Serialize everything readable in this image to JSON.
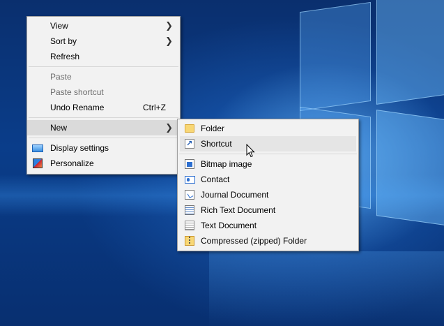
{
  "colors": {
    "menu_background": "#f2f2f2",
    "menu_highlight": "#dadada",
    "disabled_text": "#6d6d6d",
    "desktop_blue": "#0a3d8a"
  },
  "context_menu": {
    "items": [
      {
        "label": "View",
        "has_submenu": true
      },
      {
        "label": "Sort by",
        "has_submenu": true
      },
      {
        "label": "Refresh"
      },
      {
        "label": "Paste",
        "disabled": true
      },
      {
        "label": "Paste shortcut",
        "disabled": true
      },
      {
        "label": "Undo Rename",
        "shortcut": "Ctrl+Z"
      },
      {
        "label": "New",
        "has_submenu": true,
        "highlighted": true
      },
      {
        "label": "Display settings",
        "icon": "display-icon"
      },
      {
        "label": "Personalize",
        "icon": "personalize-icon"
      }
    ]
  },
  "new_submenu": {
    "items": [
      {
        "label": "Folder",
        "icon": "folder-icon"
      },
      {
        "label": "Shortcut",
        "icon": "shortcut-icon",
        "highlighted": true
      },
      {
        "label": "Bitmap image",
        "icon": "bitmap-icon"
      },
      {
        "label": "Contact",
        "icon": "contact-icon"
      },
      {
        "label": "Journal Document",
        "icon": "journal-icon"
      },
      {
        "label": "Rich Text Document",
        "icon": "rich-text-icon"
      },
      {
        "label": "Text Document",
        "icon": "text-document-icon"
      },
      {
        "label": "Compressed (zipped) Folder",
        "icon": "zip-folder-icon"
      }
    ]
  },
  "glyphs": {
    "submenu_arrow": "❯"
  }
}
